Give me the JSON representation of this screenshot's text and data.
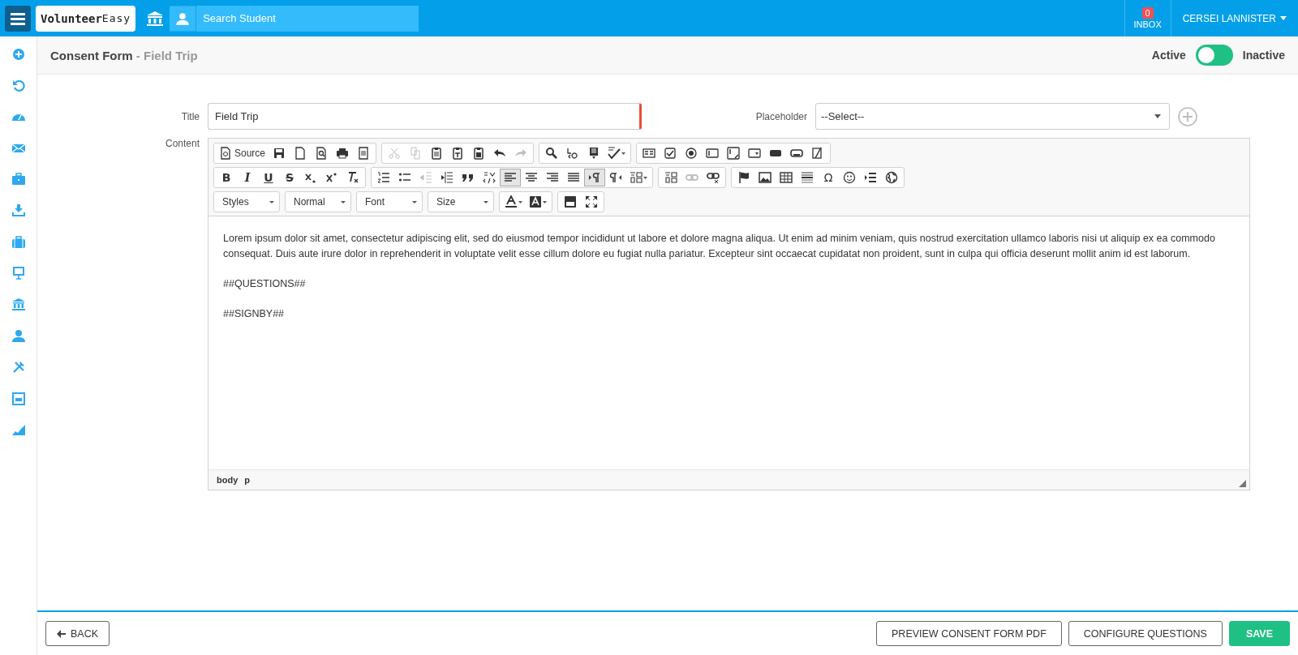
{
  "topbar": {
    "logo": {
      "word1": "Volunteer",
      "word2": "Easy"
    },
    "search": {
      "placeholder": "Search Student"
    },
    "inbox": {
      "count": "0",
      "label": "INBOX"
    },
    "user": {
      "name": "CERSEI LANNISTER"
    }
  },
  "header": {
    "title": "Consent Form",
    "subtitle": "- Field Trip",
    "status": {
      "active_label": "Active",
      "inactive_label": "Inactive",
      "inactive": false
    }
  },
  "form": {
    "title": {
      "label": "Title",
      "value": "Field Trip",
      "invalid": true
    },
    "placeholder_field": {
      "label": "Placeholder",
      "value": "--Select--"
    },
    "content_label": "Content"
  },
  "editor": {
    "toolbar": [
      [
        [
          {
            "kind": "labeled",
            "label": "Source"
          },
          {
            "kind": "icon"
          },
          {
            "kind": "icon"
          },
          {
            "kind": "icon"
          },
          {
            "kind": "icon"
          },
          {
            "kind": "icon"
          }
        ],
        [
          {
            "kind": "icon",
            "disabled": true
          },
          {
            "kind": "icon",
            "disabled": true
          },
          {
            "kind": "icon"
          },
          {
            "kind": "icon"
          },
          {
            "kind": "icon"
          },
          {
            "kind": "icon"
          },
          {
            "kind": "icon",
            "disabled": true
          }
        ],
        [
          {
            "kind": "icon"
          },
          {
            "kind": "icon"
          },
          {
            "kind": "icon"
          },
          {
            "kind": "split"
          }
        ],
        [
          {
            "kind": "icon"
          },
          {
            "kind": "icon"
          },
          {
            "kind": "icon"
          },
          {
            "kind": "icon"
          },
          {
            "kind": "icon"
          },
          {
            "kind": "icon"
          },
          {
            "kind": "icon"
          },
          {
            "kind": "icon"
          },
          {
            "kind": "icon"
          }
        ]
      ],
      [
        [
          {
            "kind": "glyph",
            "label": "B"
          },
          {
            "kind": "glyph",
            "label": "I"
          },
          {
            "kind": "glyph",
            "label": "U"
          },
          {
            "kind": "glyph",
            "label": "S"
          },
          {
            "kind": "icon"
          },
          {
            "kind": "icon"
          },
          {
            "kind": "icon"
          }
        ],
        [
          {
            "kind": "icon"
          },
          {
            "kind": "icon"
          },
          {
            "kind": "icon",
            "disabled": true
          },
          {
            "kind": "icon"
          },
          {
            "kind": "icon"
          },
          {
            "kind": "icon"
          },
          {
            "kind": "icon",
            "selected": true
          },
          {
            "kind": "icon",
            "selected": false
          },
          {
            "kind": "icon",
            "selected": false
          },
          {
            "kind": "icon",
            "selected": false
          },
          {
            "kind": "icon",
            "selected": true
          },
          {
            "kind": "icon",
            "selected": false
          },
          {
            "kind": "split"
          }
        ],
        [
          {
            "kind": "icon"
          },
          {
            "kind": "icon",
            "disabled": true
          },
          {
            "kind": "icon"
          }
        ],
        [
          {
            "kind": "icon"
          },
          {
            "kind": "icon"
          },
          {
            "kind": "icon"
          },
          {
            "kind": "icon"
          },
          {
            "kind": "glyph",
            "label": "Ω"
          },
          {
            "kind": "icon"
          },
          {
            "kind": "icon"
          },
          {
            "kind": "icon"
          }
        ]
      ],
      [
        [
          {
            "kind": "combo",
            "label": "Styles"
          }
        ],
        [
          {
            "kind": "combo",
            "label": "Normal"
          }
        ],
        [
          {
            "kind": "combo",
            "label": "Font"
          }
        ],
        [
          {
            "kind": "combo",
            "label": "Size"
          }
        ],
        [
          {
            "kind": "split"
          },
          {
            "kind": "split"
          }
        ],
        [
          {
            "kind": "icon"
          },
          {
            "kind": "icon"
          }
        ]
      ]
    ],
    "paragraphs": [
      "Lorem ipsum dolor sit amet, consectetur adipiscing elit, sed do eiusmod tempor incididunt ut labore et dolore magna aliqua. Ut enim ad minim veniam, quis nostrud exercitation ullamco laboris nisi ut aliquip ex ea commodo consequat. Duis aute irure dolor in reprehenderit in voluptate velit esse cillum dolore eu fugiat nulla pariatur. Excepteur sint occaecat cupidatat non proident, sunt in culpa qui officia deserunt mollit anim id est laborum.",
      "##QUESTIONS##",
      "##SIGNBY##"
    ],
    "path": [
      "body",
      "p"
    ]
  },
  "footer": {
    "back": "BACK",
    "actions": [
      {
        "label": "PREVIEW CONSENT FORM PDF",
        "kind": "outline"
      },
      {
        "label": "CONFIGURE QUESTIONS",
        "kind": "outline"
      },
      {
        "label": "SAVE",
        "kind": "primary"
      }
    ]
  }
}
